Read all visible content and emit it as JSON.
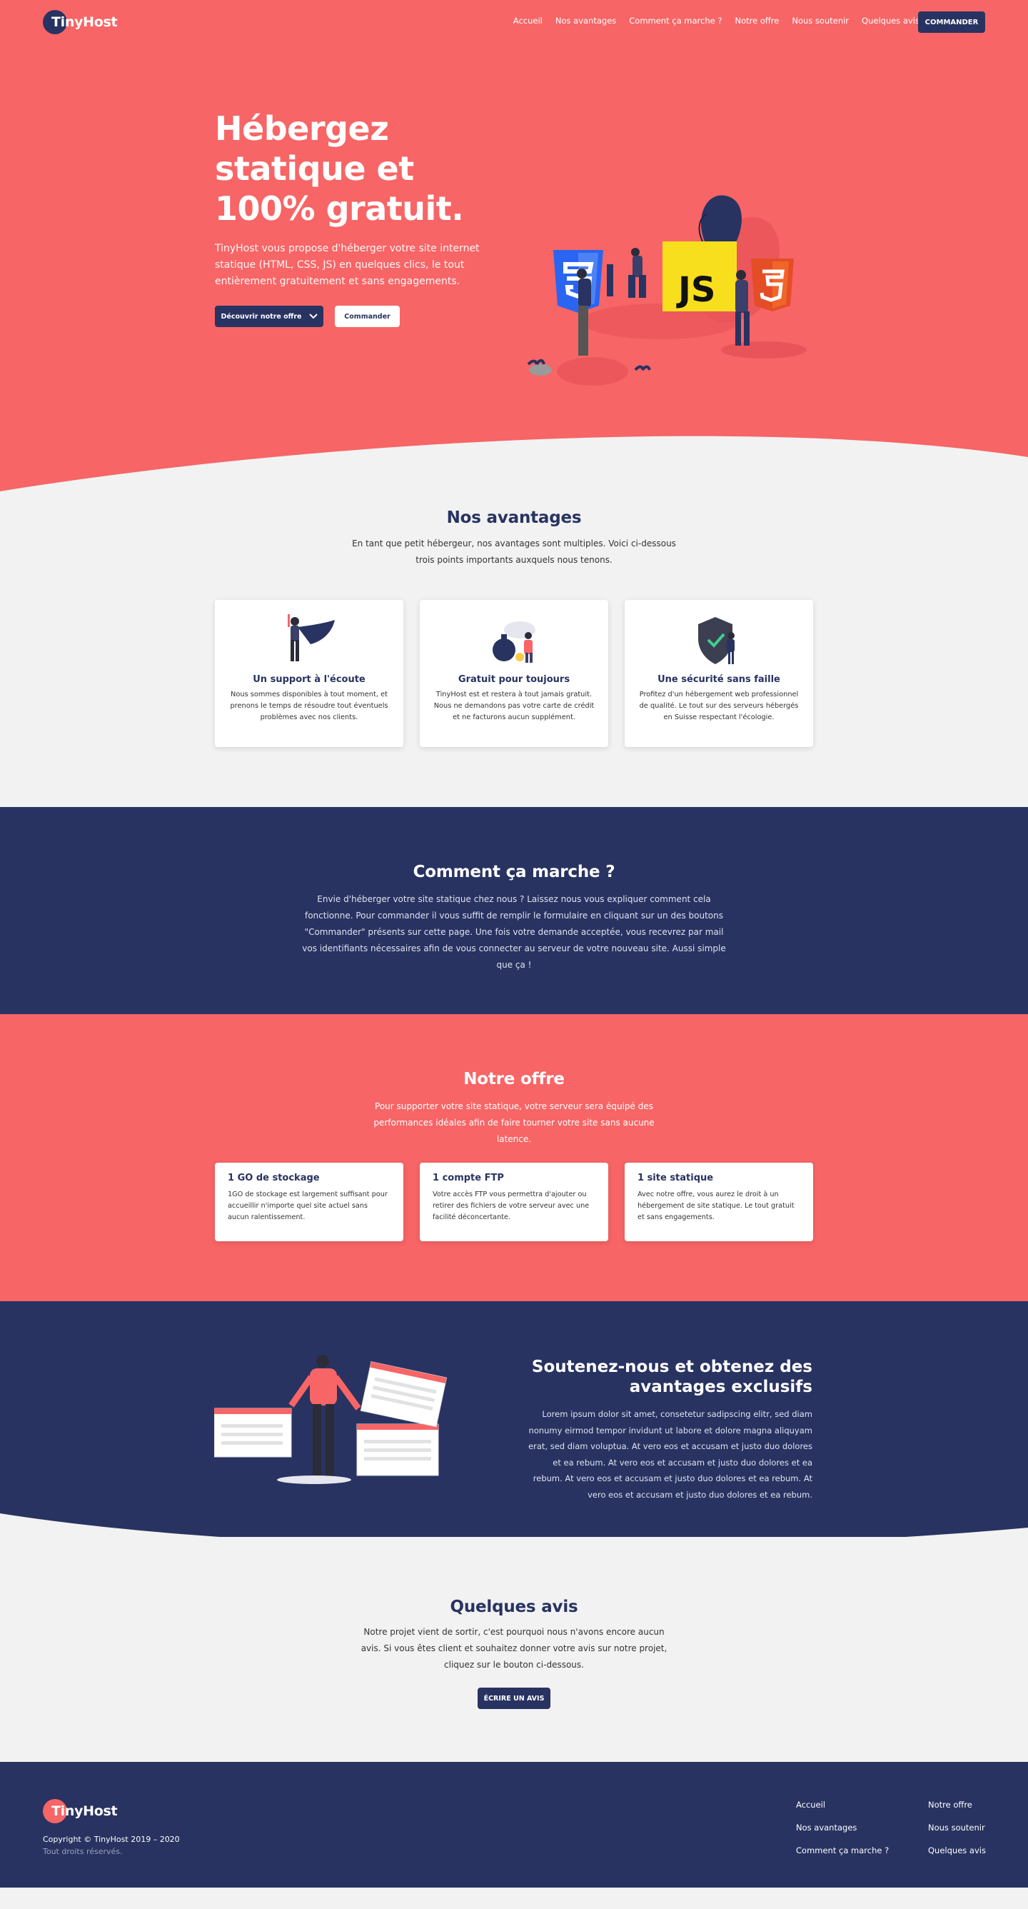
{
  "brand": {
    "name": "TinyHost",
    "accent": "#f76566",
    "navy": "#283361"
  },
  "nav": {
    "items": [
      "Accueil",
      "Nos avantages",
      "Comment ça marche ?",
      "Notre offre",
      "Nous soutenir",
      "Quelques avis"
    ],
    "cta": "COMMANDER"
  },
  "hero": {
    "title": "Hébergez statique et 100% gratuit.",
    "text": "TinyHost vous propose d'héberger votre site internet statique (HTML, CSS, JS) en quelques clics, le tout entièrement gratuitement et sans engagements.",
    "discover_label": "Découvrir notre offre",
    "order_label": "Commander",
    "illustration_labels": {
      "js": "JS"
    }
  },
  "advantages": {
    "title": "Nos avantages",
    "subtitle": "En tant que petit hébergeur, nos avantages sont multiples. Voici ci-dessous trois points importants auxquels nous tenons.",
    "cards": [
      {
        "title": "Un support à l'écoute",
        "text": "Nous sommes disponibles à tout moment, et prenons le temps de résoudre tout éventuels problèmes avec nos clients.",
        "icon": "superhero-icon"
      },
      {
        "title": "Gratuit pour toujours",
        "text": "TinyHost est et restera à tout jamais gratuit. Nous ne demandons pas votre carte de crédit et ne facturons aucun supplément.",
        "icon": "money-bag-icon"
      },
      {
        "title": "Une sécurité sans faille",
        "text": "Profitez d'un hébergement web professionnel de qualité. Le tout sur des serveurs hébergés en Suisse respectant l'écologie.",
        "icon": "shield-icon"
      }
    ]
  },
  "how": {
    "title": "Comment ça marche ?",
    "text": "Envie d'héberger votre site statique chez nous ? Laissez nous vous expliquer comment cela fonctionne. Pour commander il vous suffit de remplir le formulaire en cliquant sur un des boutons \"Commander\" présents sur cette page. Une fois votre demande acceptée, vous recevrez par mail vos identifiants nécessaires afin de vous connecter au serveur de votre nouveau site. Aussi simple que ça !"
  },
  "offer": {
    "title": "Notre offre",
    "subtitle": "Pour supporter votre site statique, votre serveur sera équipé des performances idéales afin de faire tourner votre site sans aucune latence.",
    "cards": [
      {
        "title": "1 GO de stockage",
        "text": "1GO de stockage est largement suffisant pour accueillir n'importe quel site actuel sans aucun ralentissement."
      },
      {
        "title": "1 compte FTP",
        "text": "Votre accès FTP vous permettra d'ajouter ou retirer des fichiers de votre serveur avec une facilité déconcertante."
      },
      {
        "title": "1 site statique",
        "text": "Avec notre offre, vous aurez le droit à un hébergement de site statique. Le tout gratuit et sans engagements."
      }
    ]
  },
  "support": {
    "title": "Soutenez-nous et obtenez des avantages exclusifs",
    "text": "Lorem ipsum dolor sit amet, consetetur sadipscing elitr, sed diam nonumy eirmod tempor invidunt ut labore et dolore magna aliquyam erat, sed diam voluptua. At vero eos et accusam et justo duo dolores et ea rebum. At vero eos et accusam et justo duo dolores et ea rebum. At vero eos et accusam et justo duo dolores et ea rebum. At vero eos et accusam et justo duo dolores et ea rebum."
  },
  "reviews": {
    "title": "Quelques avis",
    "text": "Notre projet vient de sortir, c'est pourquoi nous n'avons encore aucun avis. Si vous êtes client et souhaitez donner votre avis sur notre projet, cliquez sur le bouton ci-dessous.",
    "button": "ÉCRIRE UN AVIS"
  },
  "footer": {
    "brand": "TinyHost",
    "copyright": "Copyright © TinyHost 2019 – 2020",
    "rights": "Tout droits réservés.",
    "col1": [
      "Accueil",
      "Nos avantages",
      "Comment ça marche ?"
    ],
    "col2": [
      "Notre offre",
      "Nous soutenir",
      "Quelques avis"
    ]
  }
}
